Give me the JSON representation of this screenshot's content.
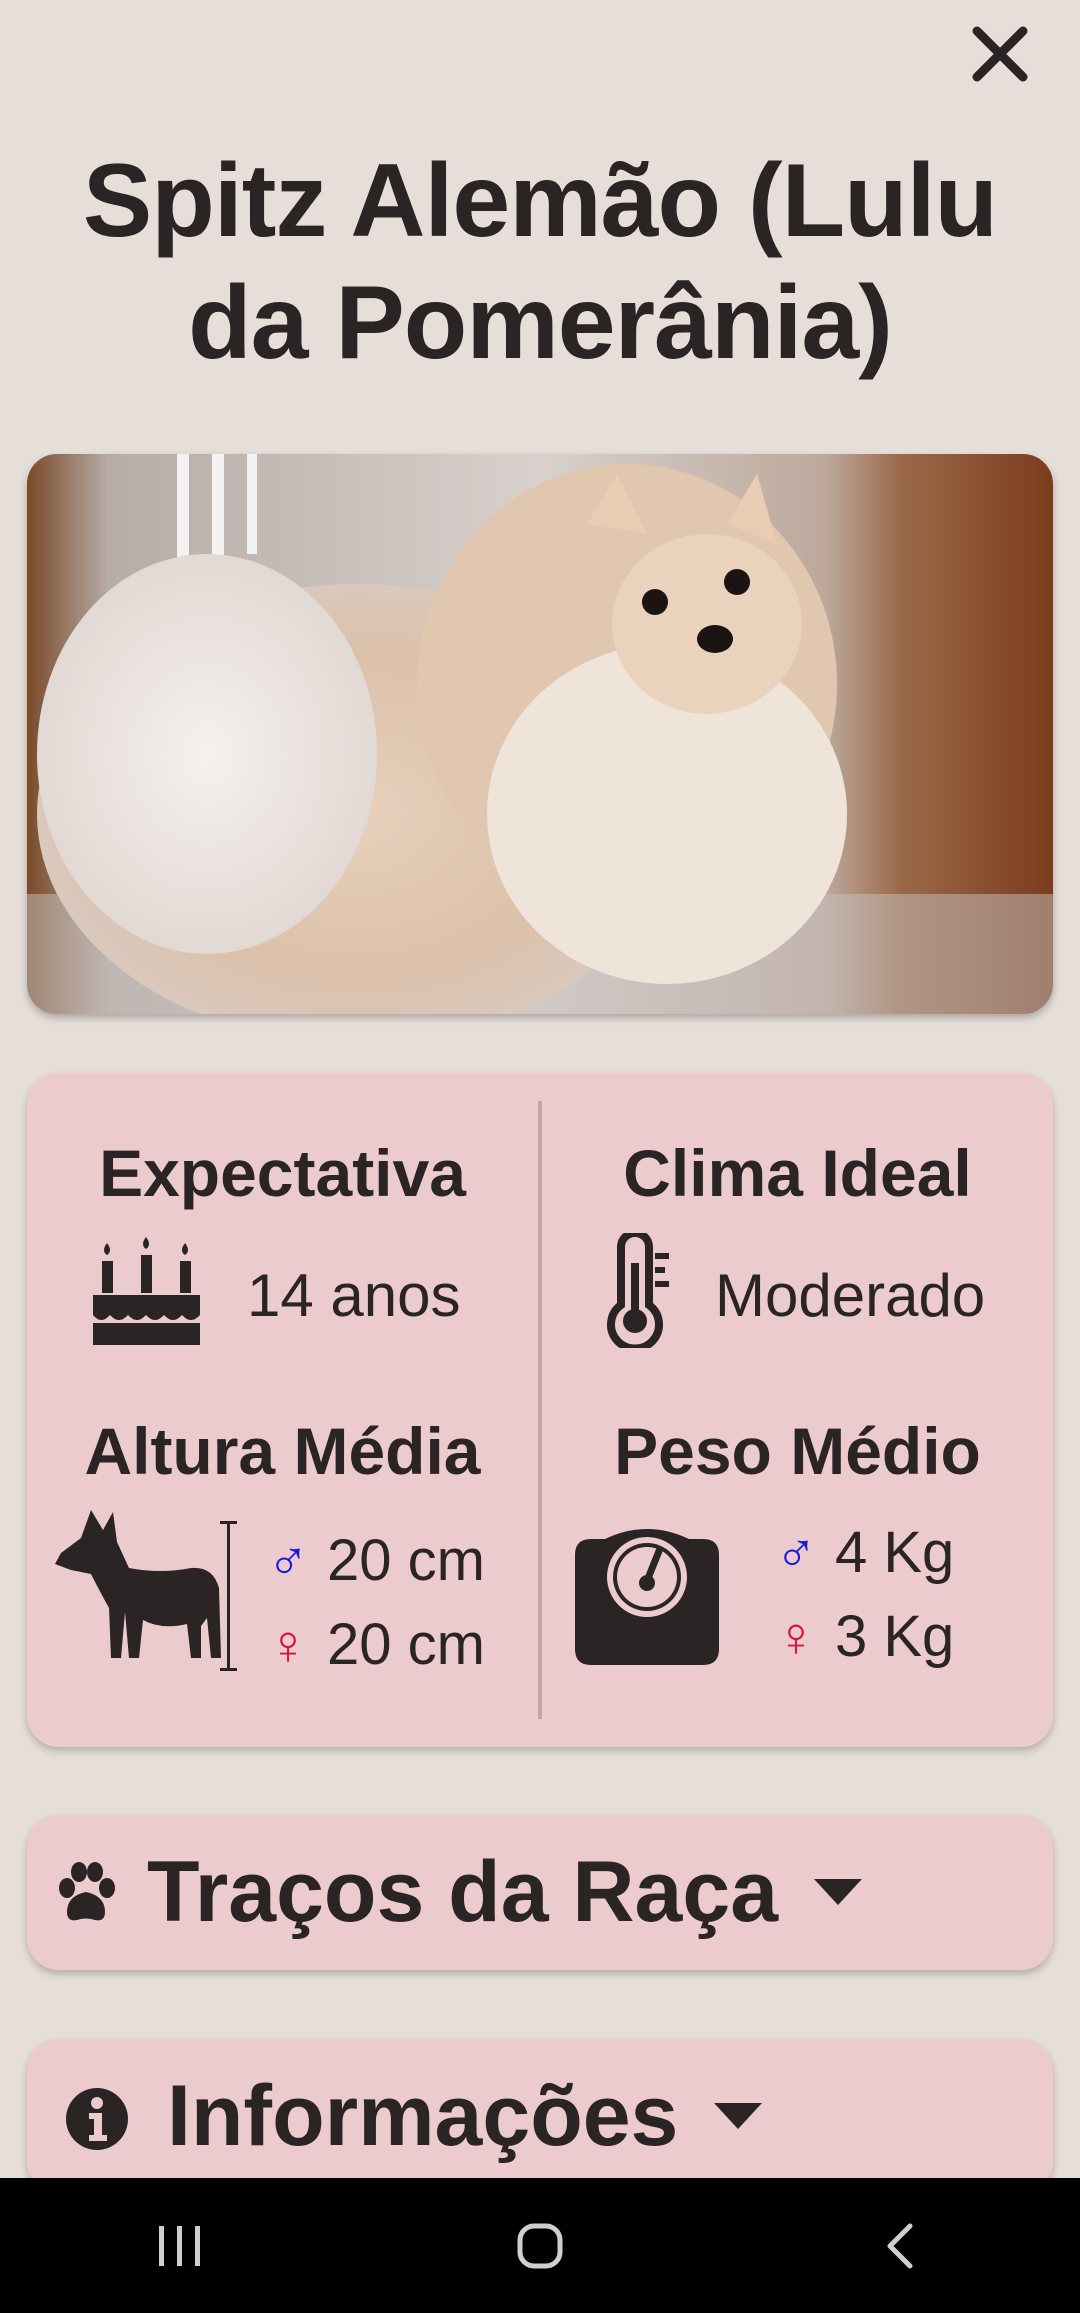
{
  "header": {
    "close_icon": "close-icon",
    "title": "Spitz Alemão (Lulu da Pomerânia)"
  },
  "photo": {
    "subject": "dog-photo"
  },
  "stats": {
    "life_expectancy": {
      "title": "Expectativa",
      "icon": "birthday-cake-icon",
      "value": "14 anos"
    },
    "ideal_climate": {
      "title": "Clima Ideal",
      "icon": "thermometer-icon",
      "value": "Moderado"
    },
    "average_height": {
      "title": "Altura Média",
      "icon": "dog-silhouette-icon",
      "male_symbol": "♂",
      "male": "20 cm",
      "female_symbol": "♀",
      "female": "20 cm"
    },
    "average_weight": {
      "title": "Peso Médio",
      "icon": "scale-icon",
      "male_symbol": "♂",
      "male": "4 Kg",
      "female_symbol": "♀",
      "female": "3 Kg"
    }
  },
  "sections": [
    {
      "label": "Traços da Raça",
      "icon": "paw-icon",
      "expand_icon": "caret-down-icon"
    },
    {
      "label": "Informações",
      "icon": "info-icon",
      "expand_icon": "caret-down-icon"
    }
  ],
  "colors": {
    "background": "#e6ded9",
    "card": "#ebcbcd",
    "male": "#1a1ad6",
    "female": "#d8163a",
    "text": "#2b2424"
  },
  "navbar": {
    "icons": [
      "recent-apps-icon",
      "home-icon",
      "back-icon"
    ]
  }
}
